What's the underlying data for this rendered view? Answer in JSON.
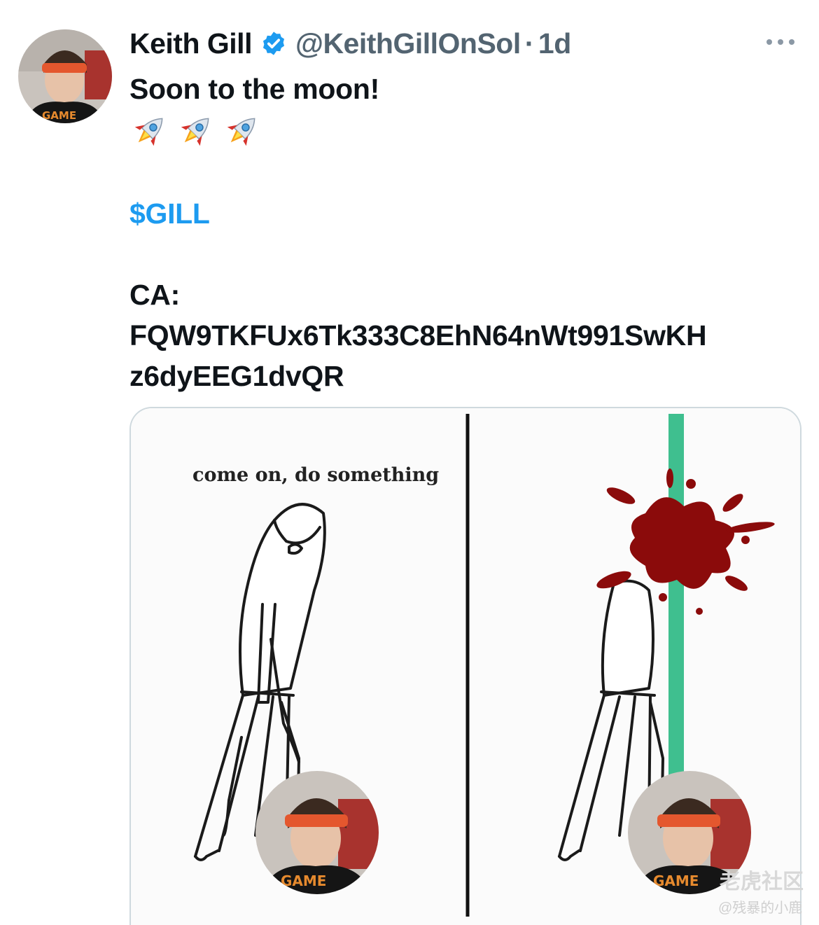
{
  "tweet": {
    "author_name": "Keith Gill",
    "handle": "@KeithGillOnSol",
    "separator": "·",
    "time": "1d",
    "line1": "Soon to the moon!",
    "rockets": [
      "🚀",
      "🚀",
      "🚀"
    ],
    "cashtag": "$GILL",
    "ca_label": "CA:",
    "ca_line1": "FQW9TKFUx6Tk333C8EhN64nWt991SwKH",
    "ca_line2": "z6dyEEG1dvQR"
  },
  "media": {
    "meme_caption": "come on, do something",
    "avatar_shirt_text": "GAME"
  },
  "watermark": {
    "brand": "老虎社区",
    "user": "@残暴的小鹿"
  },
  "colors": {
    "link": "#1d9bf0",
    "secondary_text": "#536471",
    "verified": "#1d9bf0",
    "border": "#cfd9de"
  },
  "icons": {
    "verified": "verified-badge-icon",
    "more": "more-options-icon",
    "rocket": "rocket-emoji"
  }
}
